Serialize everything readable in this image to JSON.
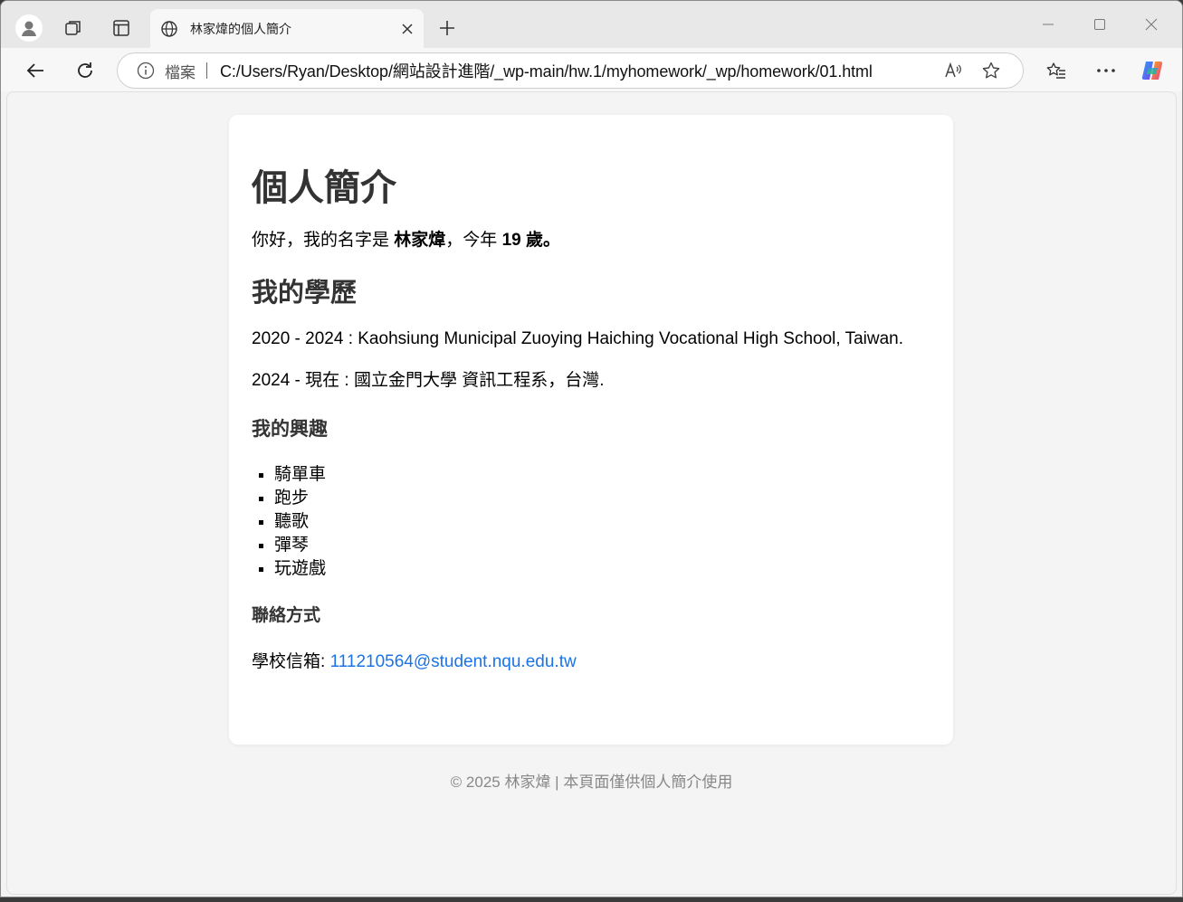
{
  "browser": {
    "tab_title": "林家煒的個人簡介",
    "address_label": "檔案",
    "url": "C:/Users/Ryan/Desktop/網站設計進階/_wp-main/hw.1/myhomework/_wp/homework/01.html"
  },
  "page": {
    "title": "個人簡介",
    "intro_prefix": "你好，我的名字是 ",
    "intro_name": "林家煒",
    "intro_mid": "，今年 ",
    "intro_age": "19 歲。",
    "education_heading": "我的學歷",
    "education": [
      "2020 - 2024 : Kaohsiung Municipal Zuoying Haiching Vocational High School, Taiwan.",
      "2024 - 現在 : 國立金門大學 資訊工程系，台灣."
    ],
    "interests_heading": "我的興趣",
    "interests": [
      "騎單車",
      "跑步",
      "聽歌",
      "彈琴",
      "玩遊戲"
    ],
    "contact_heading": "聯絡方式",
    "contact_label": "學校信箱: ",
    "contact_email": "111210564@student.nqu.edu.tw",
    "footer": "© 2025 林家煒 | 本頁面僅供個人簡介使用"
  },
  "colors": {
    "link": "#1a73e8",
    "heading": "#333333",
    "footer_text": "#888888"
  }
}
